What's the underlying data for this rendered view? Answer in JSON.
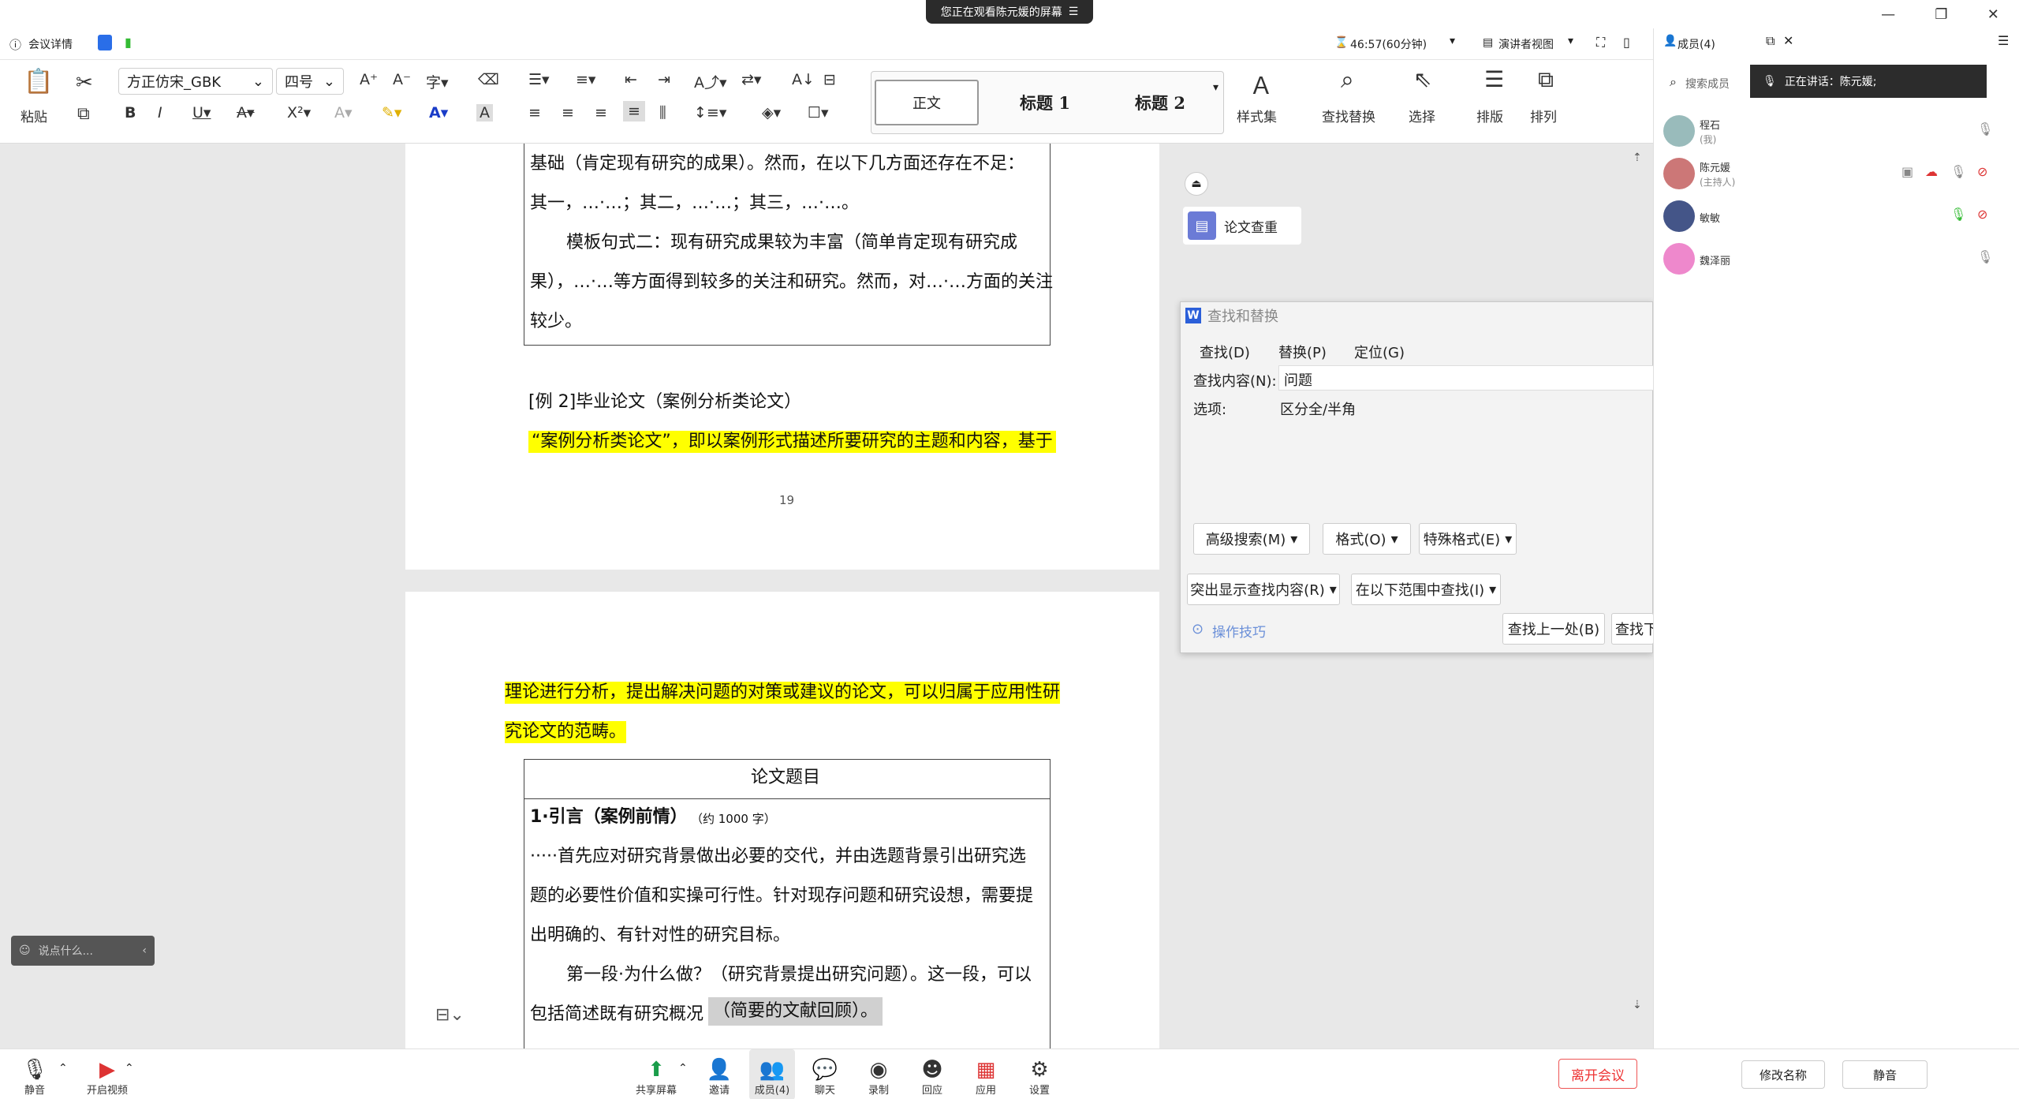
{
  "banner": {
    "text": "您正在观看陈元媛的屏幕",
    "icon": "menu-icon"
  },
  "meeting": {
    "details_label": "会议详情",
    "timer": "46:57(60分钟)",
    "view_label": "演讲者视图"
  },
  "ribbon": {
    "paste_label": "粘贴",
    "font_name": "方正仿宋_GBK",
    "font_size": "四号",
    "styles": [
      "正文",
      "标题  1",
      "标题  2"
    ],
    "style_set_label": "样式集",
    "find_replace_label": "查找替换",
    "select_label": "选择",
    "layout_label": "排版",
    "arrange_label": "排列"
  },
  "doc": {
    "p1_line1": "基础（肯定现有研究的成果）。然而，在以下几方面还存在不足：",
    "p1_line2": "其一，…·…；其二，…·…；其三，…·…。",
    "p1_line3": "模板句式二：现有研究成果较为丰富（简单肯定现有研究成",
    "p1_line4": "果），…·…等方面得到较多的关注和研究。然而，对…·…方面的关注",
    "p1_line5": "较少。",
    "example_title": "[例 2]毕业论文（案例分析类论文）",
    "hl_line1": "“案例分析类论文”，即以案例形式描述所要研究的主题和内容，基于",
    "page_number": "19",
    "hl_line2": "理论进行分析，提出解决问题的对策或建议的论文，可以归属于应用性研",
    "hl_line3": "究论文的范畴。",
    "table_title": "论文题目",
    "sec1_title": "1·引言（案例前情）",
    "sec1_note": "（约 1000 字）",
    "sec1_l1": "·····首先应对研究背景做出必要的交代，并由选题背景引出研究选",
    "sec1_l2": "题的必要性价值和实操可行性。针对现存问题和研究设想，需要提",
    "sec1_l3": "出明确的、有针对性的研究目标。",
    "sec1_l4": "第一段·为什么做？（研究背景提出研究问题）。这一段，可以",
    "sec1_l5a": "包括简述既有研究概况",
    "sec1_l5b": "（简要的文献回顾）。"
  },
  "plagiarism_label": "论文查重",
  "chat_placeholder": "说点什么...",
  "find_dialog": {
    "title": "查找和替换",
    "tabs": [
      "查找(D)",
      "替换(P)",
      "定位(G)"
    ],
    "find_label": "查找内容(N):",
    "find_value": "问题",
    "options_label": "选项:",
    "options_value": "区分全/半角",
    "adv_search": "高级搜索(M)",
    "format": "格式(O)",
    "special": "特殊格式(E)",
    "highlight": "突出显示查找内容(R)",
    "find_in": "在以下范围中查找(I)",
    "tips": "操作技巧",
    "find_prev": "查找上一处(B)",
    "find_next": "查找下"
  },
  "panel": {
    "title": "成员(4)",
    "search_placeholder": "搜索成员",
    "speaking": "正在讲话：陈元媛;",
    "members": [
      {
        "name": "程石",
        "role": "(我)",
        "color": "#9bb"
      },
      {
        "name": "陈元媛",
        "role": "(主持人)",
        "color": "#c77"
      },
      {
        "name": "敏敏",
        "role": "",
        "color": "#458"
      },
      {
        "name": "魏泽丽",
        "role": "",
        "color": "#e8c"
      }
    ],
    "rename": "修改名称",
    "mute": "静音"
  },
  "bottom": {
    "mute": "静音",
    "video": "开启视频",
    "share": "共享屏幕",
    "invite": "邀请",
    "members": "成员(4)",
    "chat": "聊天",
    "record": "录制",
    "reply": "回应",
    "apps": "应用",
    "settings": "设置",
    "leave": "离开会议"
  }
}
